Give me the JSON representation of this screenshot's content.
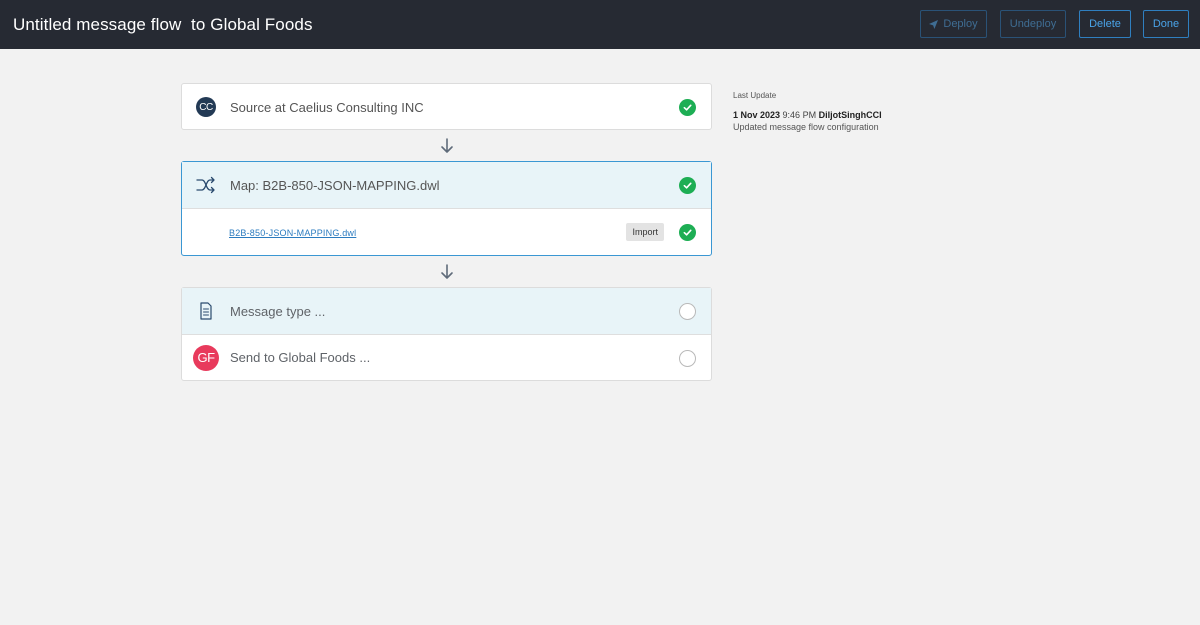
{
  "window": {
    "title": "Untitled message flow  to Global Foods"
  },
  "toolbar": {
    "deploy_label": "Deploy",
    "undeploy_label": "Undeploy",
    "delete_label": "Delete",
    "done_label": "Done"
  },
  "flow": {
    "source": {
      "badge": "CC",
      "label": "Source at Caelius Consulting INC",
      "status": "complete"
    },
    "map": {
      "label": "Map: B2B-850-JSON-MAPPING.dwl",
      "status": "complete",
      "file_link": "B2B-850-JSON-MAPPING.dwl",
      "import_label": "Import",
      "file_status": "complete"
    },
    "message_type": {
      "label": "Message type ...",
      "status": "pending"
    },
    "target": {
      "badge": "GF",
      "label": "Send to Global Foods ...",
      "status": "pending"
    }
  },
  "last_update": {
    "heading": "Last Update",
    "date": "1 Nov 2023",
    "time": "9:46 PM",
    "user": "DiljotSinghCCI",
    "description": "Updated message flow configuration"
  },
  "colors": {
    "topbar": "#262a33",
    "accent": "#3a97d3",
    "success": "#1dae54",
    "gf_badge": "#e83a5c",
    "cc_badge": "#233a55"
  }
}
